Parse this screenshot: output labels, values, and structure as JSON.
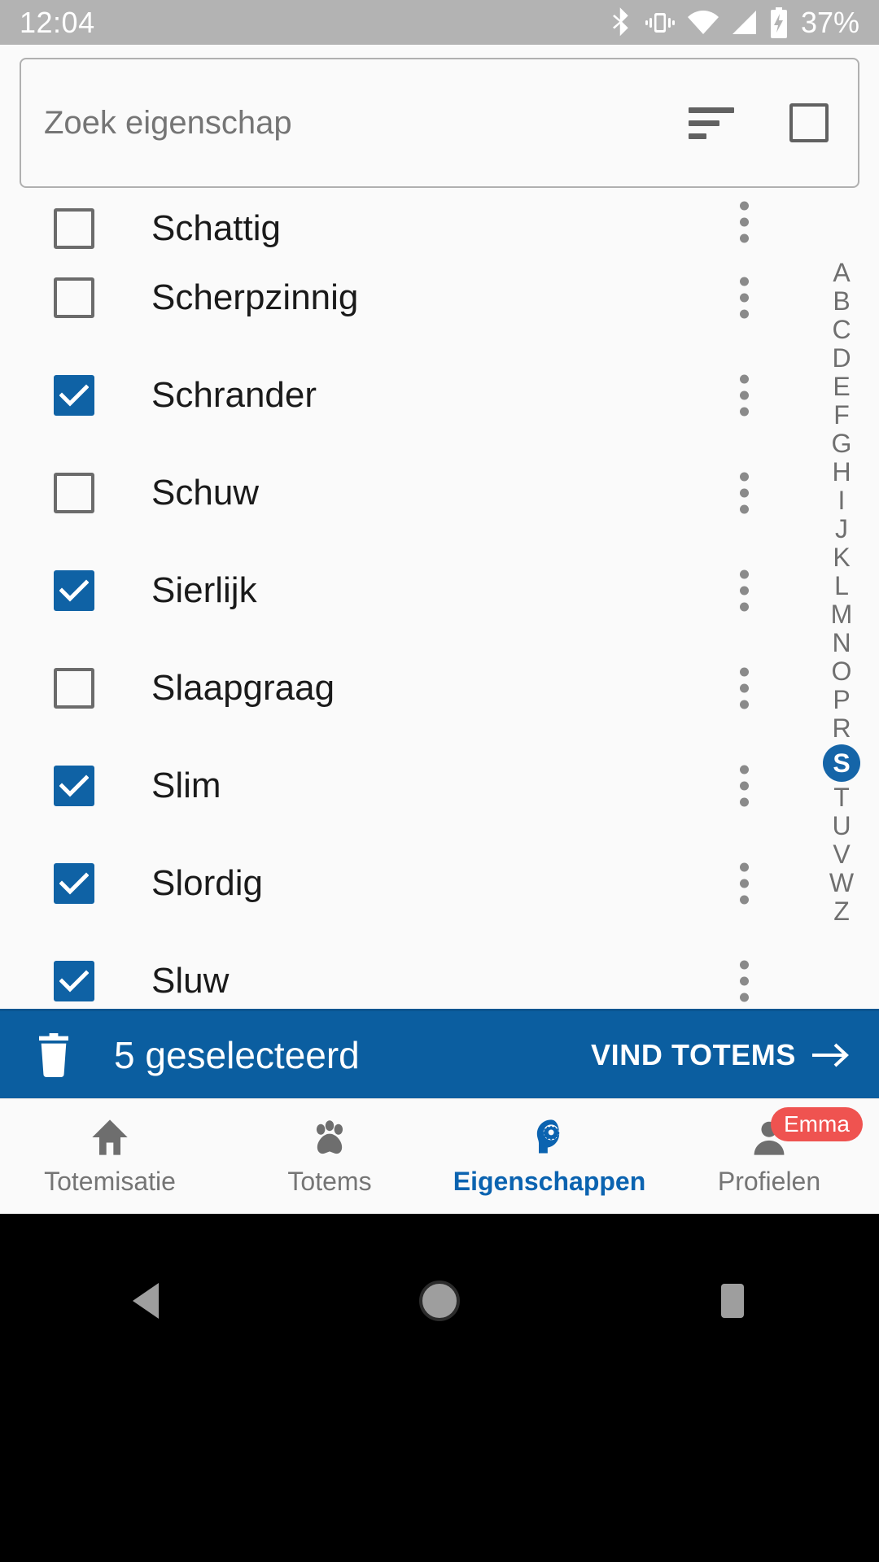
{
  "statusbar": {
    "time": "12:04",
    "battery_percent": "37%",
    "icons": [
      "bluetooth-icon",
      "vibrate-icon",
      "wifi-icon",
      "cellular-signal-icon",
      "battery-charging-icon"
    ]
  },
  "search": {
    "placeholder": "Zoek eigenschap",
    "value": "",
    "sort_icon": "sort-icon",
    "select_all_icon": "select-all-checkbox-icon"
  },
  "list": {
    "rows": [
      {
        "label": "Schattig",
        "checked": false,
        "clipped": true
      },
      {
        "label": "Scherpzinnig",
        "checked": false,
        "clipped": false
      },
      {
        "label": "Schrander",
        "checked": true,
        "clipped": false
      },
      {
        "label": "Schuw",
        "checked": false,
        "clipped": false
      },
      {
        "label": "Sierlijk",
        "checked": true,
        "clipped": false
      },
      {
        "label": "Slaapgraag",
        "checked": false,
        "clipped": false
      },
      {
        "label": "Slim",
        "checked": true,
        "clipped": false
      },
      {
        "label": "Slordig",
        "checked": true,
        "clipped": false
      },
      {
        "label": "Sluw",
        "checked": true,
        "clipped": false
      }
    ],
    "row_menu_icon": "kebab-menu-icon"
  },
  "alphabet_index": {
    "letters": [
      "A",
      "B",
      "C",
      "D",
      "E",
      "F",
      "G",
      "H",
      "I",
      "J",
      "K",
      "L",
      "M",
      "N",
      "O",
      "P",
      "R",
      "S",
      "T",
      "U",
      "V",
      "W",
      "Z"
    ],
    "active": "S"
  },
  "actionbar": {
    "delete_icon": "trash-icon",
    "selected_text": "5 geselecteerd",
    "primary_action": "VIND TOTEMS",
    "arrow_icon": "arrow-right-icon",
    "background_color": "#0b5ea0"
  },
  "bottomnav": {
    "items": [
      {
        "label": "Totemisatie",
        "icon": "home-icon",
        "active": false,
        "badge": ""
      },
      {
        "label": "Totems",
        "icon": "paw-icon",
        "active": false,
        "badge": ""
      },
      {
        "label": "Eigenschappen",
        "icon": "head-gear-icon",
        "active": true,
        "badge": ""
      },
      {
        "label": "Profielen",
        "icon": "person-icon",
        "active": false,
        "badge": "Emma"
      }
    ],
    "active_color": "#0b63b0",
    "badge_color": "#ef5350"
  },
  "androidnav": {
    "buttons": [
      "back-triangle-icon",
      "home-circle-icon",
      "recents-square-icon"
    ]
  },
  "colors": {
    "accent": "#0f62a5",
    "statusbar": "#b3b3b3",
    "page_background": "#fafafa"
  }
}
